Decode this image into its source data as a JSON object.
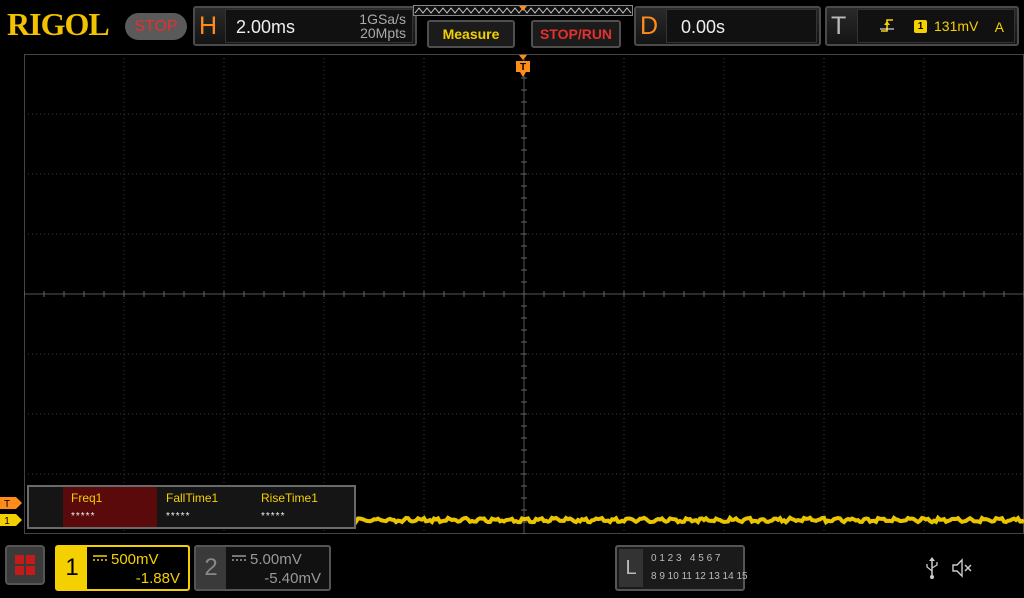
{
  "header": {
    "brand": "RIGOL",
    "run_state": "STOP",
    "horizontal": {
      "letter": "H",
      "timebase": "2.00ms",
      "sample_rate": "1GSa/s",
      "memory_depth": "20Mpts"
    },
    "measure_button": "Measure",
    "stoprun_button": "STOP/RUN",
    "delay": {
      "letter": "D",
      "value": "0.00s"
    },
    "trigger": {
      "letter": "T",
      "source": "1",
      "level": "131mV",
      "mode": "A",
      "edge_icon": "rising-edge-icon"
    }
  },
  "markers": {
    "trigger_position": "T",
    "trigger_level": "T",
    "channel1": "1"
  },
  "measurements": [
    {
      "name": "Freq1",
      "value": "*****",
      "active": true
    },
    {
      "name": "FallTime1",
      "value": "*****",
      "active": false
    },
    {
      "name": "RiseTime1",
      "value": "*****",
      "active": false
    }
  ],
  "channels": [
    {
      "number": "1",
      "scale": "500mV",
      "offset": "-1.88V",
      "coupling_icon": "dc-coupling-icon",
      "color": "#f5d000",
      "active": true
    },
    {
      "number": "2",
      "scale": "5.00mV",
      "offset": "-5.40mV",
      "coupling_icon": "dc-coupling-icon",
      "color": "#999999",
      "active": false
    }
  ],
  "logic_analyzer": {
    "letter": "L",
    "row1": "0 1 2 3   4 5 6 7",
    "row2": "8 9 10 11 12 13 14 15"
  },
  "status_icons": [
    "usb-icon",
    "mute-icon"
  ],
  "colors": {
    "brand": "#f2c200",
    "stop": "#e53030",
    "channel1": "#f5d000",
    "accent_orange": "#ff8c1a"
  }
}
